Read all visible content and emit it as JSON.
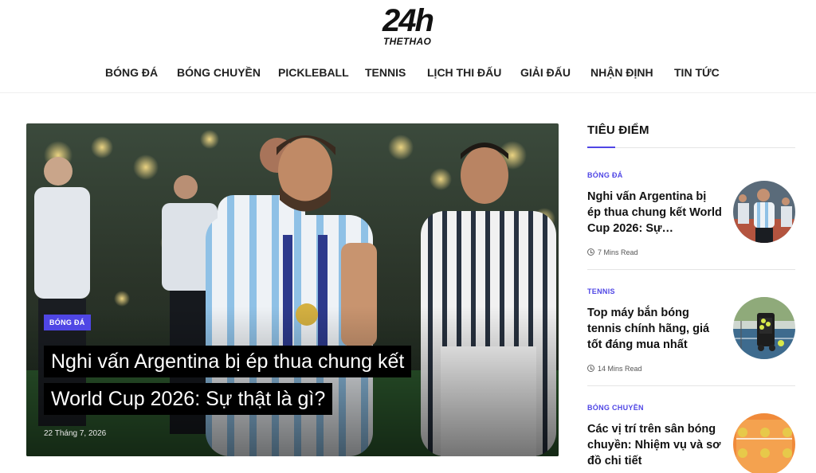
{
  "logo": {
    "number": "24h",
    "sub": "THETHAO"
  },
  "nav": [
    "BÓNG ĐÁ",
    "BÓNG CHUYỀN",
    "PICKLEBALL",
    "TENNIS",
    "LỊCH THI ĐẤU",
    "GIẢI ĐẤU",
    "NHẬN ĐỊNH",
    "TIN TỨC"
  ],
  "hero": {
    "category": "BÓNG ĐÁ",
    "title": "Nghi vấn Argentina bị ép thua chung kết World Cup 2026: Sự thật là gì?",
    "date": "22 Tháng 7, 2026"
  },
  "sidebar": {
    "title": "TIÊU ĐIỂM",
    "items": [
      {
        "category": "BÓNG ĐÁ",
        "title": "Nghi vấn Argentina bị ép thua chung kết World Cup 2026: Sự…",
        "read": "7 Mins Read"
      },
      {
        "category": "TENNIS",
        "title": "Top máy bắn bóng tennis chính hãng, giá tốt đáng mua nhất",
        "read": "14 Mins Read"
      },
      {
        "category": "BÓNG CHUYỀN",
        "title": "Các vị trí trên sân bóng chuyền: Nhiệm vụ và sơ đồ chi tiết",
        "read": ""
      }
    ]
  },
  "colors": {
    "accent": "#4f46e5",
    "text": "#111111"
  }
}
